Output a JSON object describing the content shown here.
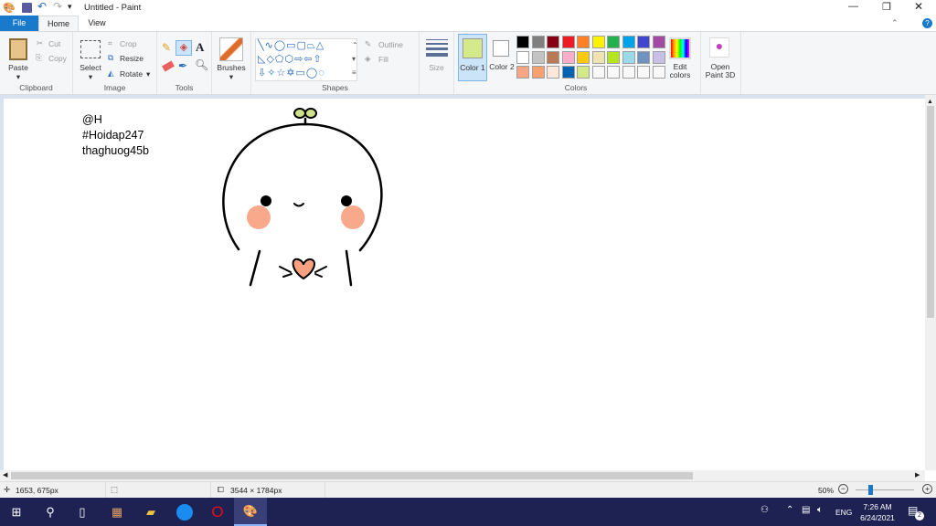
{
  "window": {
    "title": "Untitled - Paint"
  },
  "tabs": [
    {
      "label": "File"
    },
    {
      "label": "Home"
    },
    {
      "label": "View"
    }
  ],
  "clipboard": {
    "paste": "Paste",
    "cut": "Cut",
    "copy": "Copy",
    "group": "Clipboard"
  },
  "image": {
    "select": "Select",
    "crop": "Crop",
    "resize": "Resize",
    "rotate": "Rotate",
    "group": "Image"
  },
  "tools": {
    "group": "Tools"
  },
  "brushes": {
    "label": "Brushes"
  },
  "shapes": {
    "outline": "Outline",
    "fill": "Fill",
    "group": "Shapes"
  },
  "size": {
    "label": "Size"
  },
  "colors": {
    "color1": "Color 1",
    "color2": "Color 2",
    "edit": "Edit colors",
    "group": "Colors",
    "color1_value": "#d4ea8a",
    "color2_value": "#ffffff",
    "palette": [
      "#000000",
      "#7f7f7f",
      "#880015",
      "#ed1c24",
      "#ff7f27",
      "#fff200",
      "#22b14c",
      "#00a2e8",
      "#3f48cc",
      "#a349a4",
      "#ffffff",
      "#c3c3c3",
      "#b97a57",
      "#ffaec9",
      "#ffc90e",
      "#efe4b0",
      "#b5e61d",
      "#99d9ea",
      "#7092be",
      "#c8bfe7",
      "#f9a485",
      "#f9a070",
      "#fde9dc",
      "#0063b1",
      "#d4ea8a",
      "#f8f8f8",
      "#f8f8f8",
      "#f8f8f8",
      "#f8f8f8",
      "#f8f8f8"
    ]
  },
  "paint3d": {
    "label": "Open Paint 3D"
  },
  "canvas_text": {
    "line1": "@H",
    "line2": "#Hoidap247",
    "line3": "thaghuog45b"
  },
  "status": {
    "cursor": "1653, 675px",
    "size": "3544 × 1784px",
    "zoom": "50%",
    "zoom_level": 50
  },
  "taskbar": {
    "lang": "ENG",
    "time": "7:26 AM",
    "date": "6/24/2021",
    "notifications": "2"
  }
}
